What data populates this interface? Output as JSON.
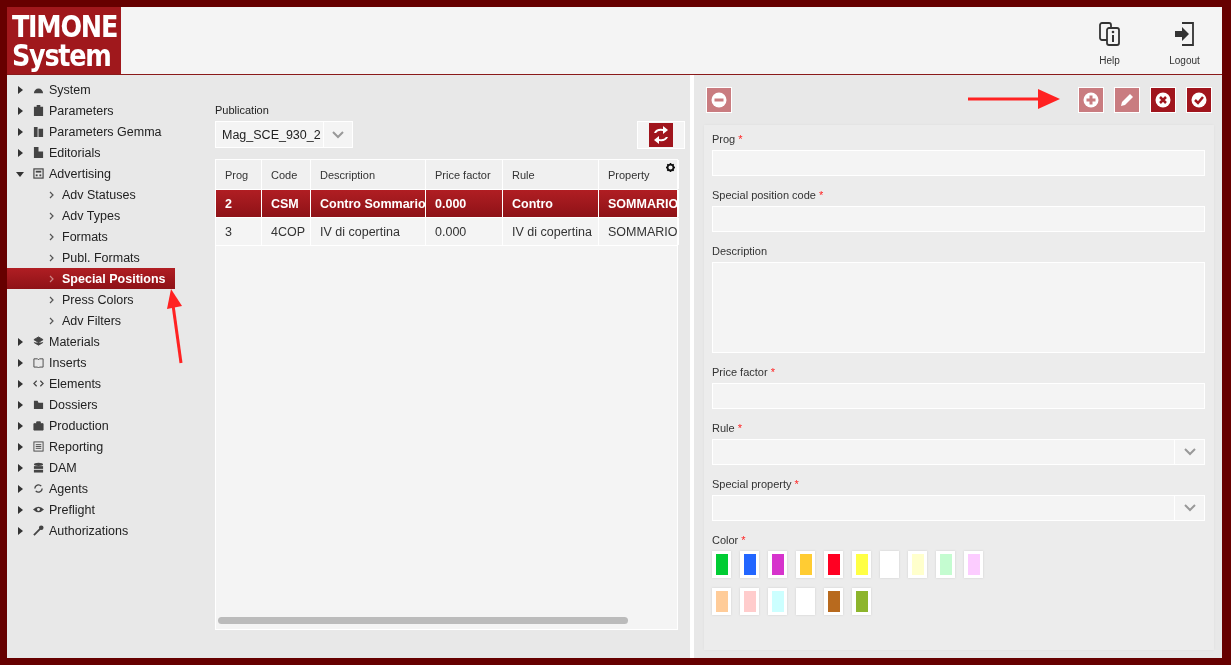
{
  "header": {
    "logo": [
      "TIMONE",
      "System"
    ],
    "actions": [
      {
        "label": "Help"
      },
      {
        "label": "Logout"
      }
    ]
  },
  "sidebar": {
    "items": [
      {
        "label": "System",
        "expanded": false,
        "selected": false
      },
      {
        "label": "Parameters",
        "expanded": false,
        "selected": false
      },
      {
        "label": "Parameters Gemma",
        "expanded": false,
        "selected": false
      },
      {
        "label": "Editorials",
        "expanded": false,
        "selected": false
      },
      {
        "label": "Advertising",
        "expanded": true,
        "selected": false,
        "children": [
          {
            "label": "Adv Statuses",
            "selected": false
          },
          {
            "label": "Adv Types",
            "selected": false
          },
          {
            "label": "Formats",
            "selected": false
          },
          {
            "label": "Publ. Formats",
            "selected": false
          },
          {
            "label": "Special Positions",
            "selected": true
          },
          {
            "label": "Press Colors",
            "selected": false
          },
          {
            "label": "Adv Filters",
            "selected": false
          }
        ]
      },
      {
        "label": "Materials",
        "expanded": false,
        "selected": false
      },
      {
        "label": "Inserts",
        "expanded": false,
        "selected": false
      },
      {
        "label": "Elements",
        "expanded": false,
        "selected": false
      },
      {
        "label": "Dossiers",
        "expanded": false,
        "selected": false
      },
      {
        "label": "Production",
        "expanded": false,
        "selected": false
      },
      {
        "label": "Reporting",
        "expanded": false,
        "selected": false
      },
      {
        "label": "DAM",
        "expanded": false,
        "selected": false
      },
      {
        "label": "Agents",
        "expanded": false,
        "selected": false
      },
      {
        "label": "Preflight",
        "expanded": false,
        "selected": false
      },
      {
        "label": "Authorizations",
        "expanded": false,
        "selected": false
      }
    ]
  },
  "list": {
    "publication_label": "Publication",
    "publication_value": "Mag_SCE_930_2",
    "table": {
      "columns": [
        "Prog",
        "Code",
        "Description",
        "Price factor",
        "Rule",
        "Property"
      ],
      "rows": [
        {
          "cells": [
            "2",
            "CSM",
            "Contro Sommario",
            "0.000",
            "Contro",
            "SOMMARIO"
          ],
          "selected": true
        },
        {
          "cells": [
            "3",
            "4COP",
            "IV di copertina",
            "0.000",
            "IV di copertina",
            "SOMMARIO"
          ],
          "selected": false
        }
      ]
    }
  },
  "detail": {
    "toolbar": [
      {
        "kind": "remove",
        "disabled": true
      },
      {
        "kind": "add",
        "disabled": true
      },
      {
        "kind": "edit",
        "disabled": true
      },
      {
        "kind": "cancel",
        "disabled": false
      },
      {
        "kind": "confirm",
        "disabled": false
      }
    ],
    "fields": [
      {
        "kind": "text",
        "label": "Prog",
        "required_mark": "*"
      },
      {
        "kind": "text",
        "label": "Special position code",
        "required_mark": "*"
      },
      {
        "kind": "textarea",
        "label": "Description"
      },
      {
        "kind": "text",
        "label": "Price factor",
        "required_mark": "*"
      },
      {
        "kind": "select",
        "label": "Rule",
        "required_mark": "*"
      },
      {
        "kind": "select",
        "label": "Special property",
        "required_mark": "*"
      },
      {
        "kind": "colors",
        "label": "Color",
        "required_mark": "*"
      }
    ],
    "swatches": [
      {
        "color": "#00cc33"
      },
      {
        "color": "#2266ff"
      },
      {
        "color": "#d633cc"
      },
      {
        "color": "#ffcc33"
      },
      {
        "color": "#ff0022"
      },
      {
        "color": "#ffff44"
      },
      {
        "color": "#ffffff"
      },
      {
        "color": "#ffffcc"
      },
      {
        "color": "#c4fcd0"
      },
      {
        "color": "#fcccff"
      },
      {
        "color": "#ffcc99"
      },
      {
        "color": "#ffcccc"
      },
      {
        "color": "#ccffff"
      },
      {
        "color": "#ffffff"
      },
      {
        "color": "#b86a1e"
      },
      {
        "color": "#8db52c"
      }
    ]
  }
}
